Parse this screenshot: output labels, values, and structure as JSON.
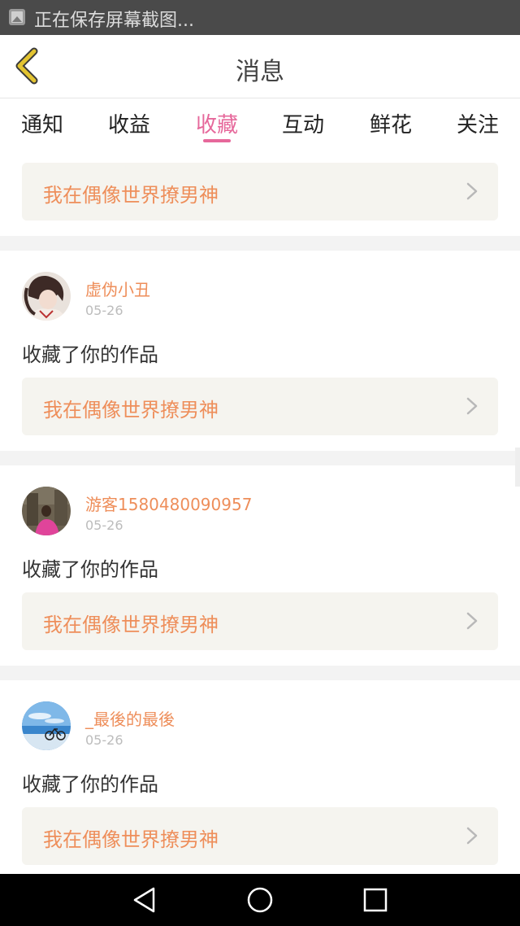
{
  "status_bar": {
    "text": "正在保存屏幕截图...",
    "icon": "image-icon"
  },
  "header": {
    "title": "消息",
    "back_icon": "chevron-left-icon"
  },
  "tabs": [
    {
      "label": "通知",
      "active": false
    },
    {
      "label": "收益",
      "active": false
    },
    {
      "label": "收藏",
      "active": true
    },
    {
      "label": "互动",
      "active": false
    },
    {
      "label": "鲜花",
      "active": false
    },
    {
      "label": "关注",
      "active": false
    }
  ],
  "top_work": {
    "title": "我在偶像世界撩男神"
  },
  "messages": [
    {
      "username": "虚伪小丑",
      "date": "05-26",
      "action": "收藏了你的作品",
      "work_title": "我在偶像世界撩男神"
    },
    {
      "username": "游客1580480090957",
      "date": "05-26",
      "action": "收藏了你的作品",
      "work_title": "我在偶像世界撩男神"
    },
    {
      "username": "_最後的最後",
      "date": "05-26",
      "action": "收藏了你的作品",
      "work_title": "我在偶像世界撩男神"
    }
  ],
  "nav_bar": {
    "icons": [
      "back-triangle-icon",
      "home-circle-icon",
      "recents-square-icon"
    ]
  },
  "colors": {
    "accent_pink": "#e6689b",
    "accent_orange": "#ee8e5a",
    "back_arrow": "#e3c431",
    "work_box_bg": "#f5f4ef"
  }
}
